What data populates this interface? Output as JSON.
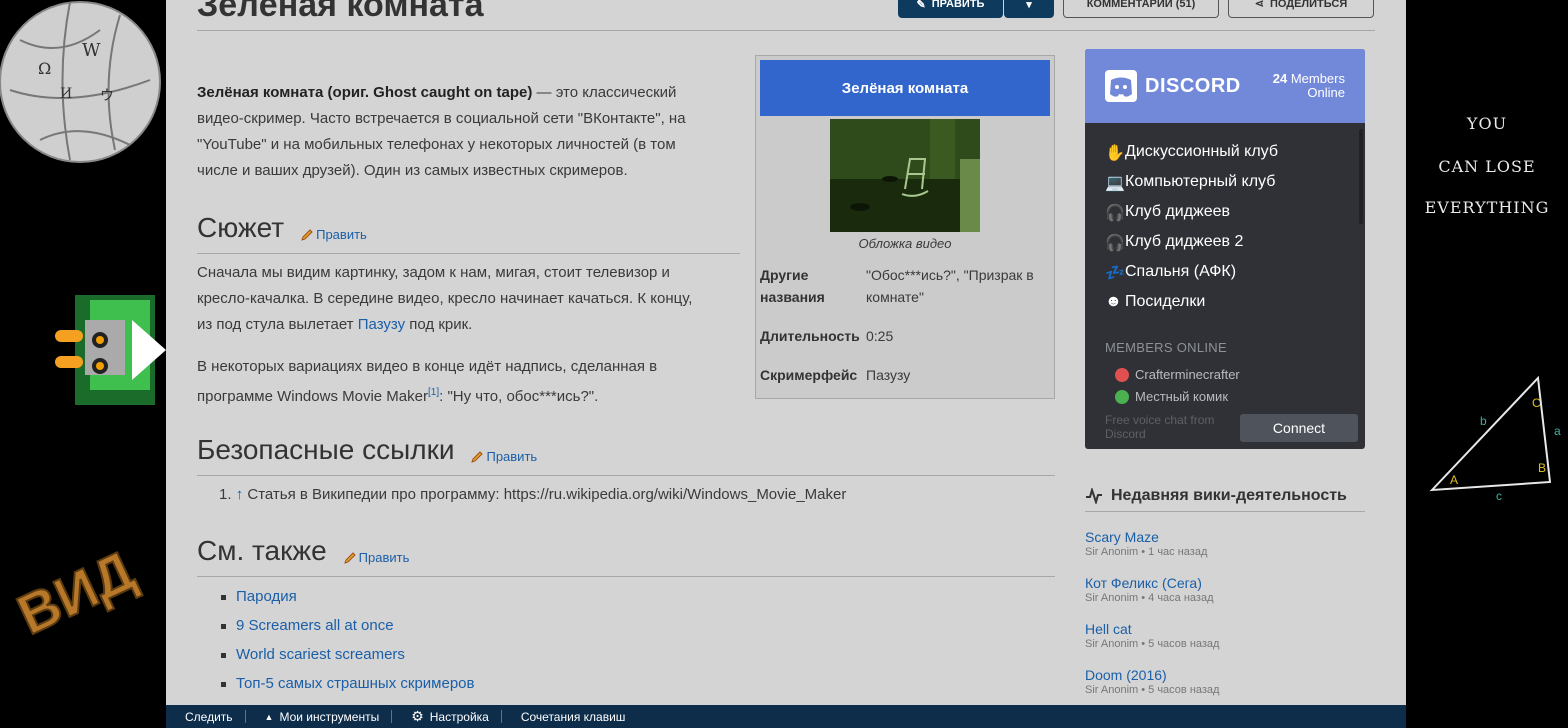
{
  "page": {
    "title": "Зелёная комната"
  },
  "header_buttons": {
    "edit": "ПРАВИТЬ",
    "comments": "КОММЕНТАРИИ (51)",
    "share": "ПОДЕЛИТЬСЯ"
  },
  "intro": {
    "bold": "Зелёная комната (ориг. Ghost caught on tape)",
    "line1_rest": " — это классический",
    "line2": "видео-скример. Часто встречается в социальной сети \"ВКонтакте\", на",
    "line3": "\"YouTube\" и на мобильных телефонах у некоторых личностей (в том",
    "line4": "числе и ваших друзей). Один из самых известных скримеров."
  },
  "sections": {
    "plot": {
      "title": "Сюжет",
      "edit": "Править",
      "p1_line1": "Сначала мы видим картинку, задом к нам, мигая, стоит телевизор и",
      "p1_line2": "кресло-качалка. В середине видео, кресло начинает качаться. К концу,",
      "p1_line3_a": "из под стула вылетает ",
      "p1_line3_link": "Пазузу",
      "p1_line3_b": " под крик.",
      "p2_line1": "В некоторых вариациях видео в конце идёт надпись, сделанная в",
      "p2_line2_a": "программе Windows Movie Maker",
      "p2_ref": "[1]",
      "p2_line2_b": ": \"Ну что, обос***ись?\"."
    },
    "links": {
      "title": "Безопасные ссылки",
      "edit": "Править",
      "item_num": "1.",
      "item_arrow": "↑",
      "item_text": " Статья в Википедии про программу: https://ru.wikipedia.org/wiki/Windows_Movie_Maker"
    },
    "see_also": {
      "title": "См. также",
      "edit": "Править",
      "items": [
        "Пародия",
        "9 Screamers all at once",
        "World scariest screamers",
        "Топ-5 самых страшных скримеров"
      ]
    }
  },
  "infobox": {
    "title": "Зелёная комната",
    "caption": "Обложка видео",
    "rows": [
      {
        "label": "Другие названия",
        "value": "\"Обос***ись?\", \"Призрак в комнате\""
      },
      {
        "label": "Длительность",
        "value": "0:25"
      },
      {
        "label": "Скримерфейс",
        "value": "Пазузу"
      }
    ]
  },
  "discord": {
    "brand": "DISCORD",
    "members_count": "24",
    "members_label": " Members",
    "online_label": "Online",
    "channels": [
      {
        "icon": "hand-icon",
        "name": "Дискуссионный клуб"
      },
      {
        "icon": "laptop-icon",
        "name": "Компьютерный клуб"
      },
      {
        "icon": "headphones-icon",
        "name": "Клуб диджеев"
      },
      {
        "icon": "headphones-icon",
        "name": "Клуб диджеев 2"
      },
      {
        "icon": "sleep-icon",
        "name": "Спальня (АФК)"
      },
      {
        "icon": "party-icon",
        "name": "Посиделки"
      }
    ],
    "members_online_label": "MEMBERS ONLINE",
    "members": [
      "Crafterminecrafter",
      "Местный комик"
    ],
    "footer": "Free voice chat from Discord",
    "connect": "Connect",
    "colors": {
      "header": "#7289da",
      "body": "#2f3136"
    }
  },
  "recent_activity": {
    "title": "Недавняя вики-деятельность",
    "items": [
      {
        "title": "Scary Maze",
        "meta": "Sir Anonim • 1 час назад"
      },
      {
        "title": "Кот Феликс (Сега)",
        "meta": "Sir Anonim • 4 часа назад"
      },
      {
        "title": "Hell cat",
        "meta": "Sir Anonim • 5 часов назад"
      },
      {
        "title": "Doom (2016)",
        "meta": "Sir Anonim • 5 часов назад"
      }
    ]
  },
  "toolbar": {
    "follow": "Следить",
    "my_tools": "Мои инструменты",
    "settings": "Настройка",
    "shortcuts": "Сочетания клавиш"
  },
  "side_text": {
    "l1": "YOU",
    "l2": "CAN LOSE",
    "l3": "EVERYTHING",
    "vid_logo": "ВИД"
  }
}
